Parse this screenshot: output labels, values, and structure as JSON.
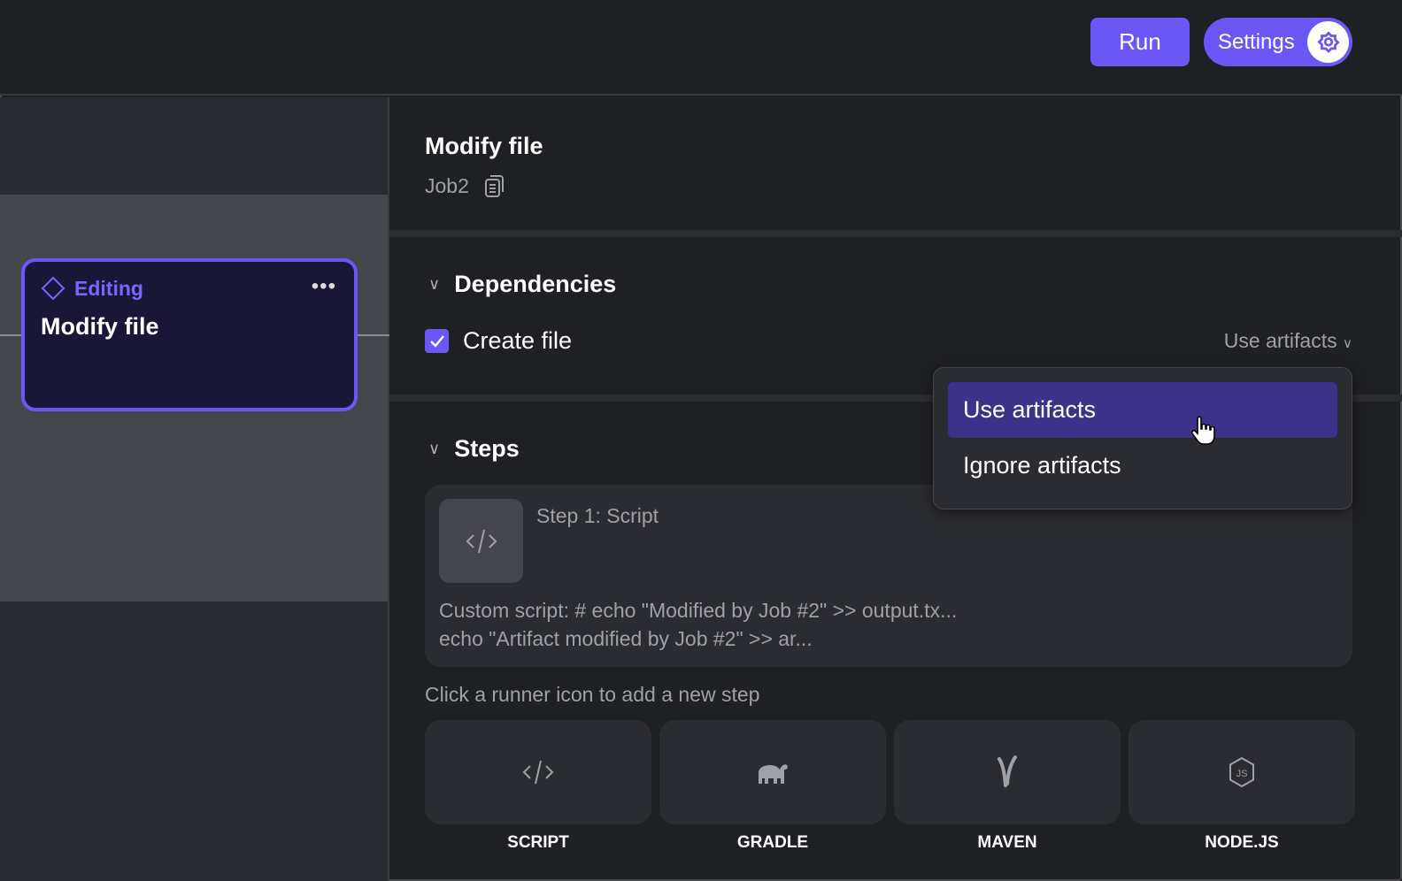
{
  "header": {
    "run_label": "Run",
    "settings_label": "Settings"
  },
  "node": {
    "status": "Editing",
    "title": "Modify file"
  },
  "job": {
    "title": "Modify file",
    "id": "Job2"
  },
  "dependencies": {
    "heading": "Dependencies",
    "items": [
      {
        "label": "Create file",
        "checked": true,
        "mode": "Use artifacts"
      }
    ]
  },
  "dropdown": {
    "options": [
      "Use artifacts",
      "Ignore artifacts"
    ],
    "selected": "Use artifacts"
  },
  "steps": {
    "heading": "Steps",
    "items": [
      {
        "title": "Step 1: Script",
        "line1": "Custom script: # echo \"Modified by Job #2\" >> output.tx...",
        "line2": "echo \"Artifact modified by Job #2\" >> ar..."
      }
    ],
    "hint": "Click a runner icon to add a new step"
  },
  "runners": [
    "SCRIPT",
    "GRADLE",
    "MAVEN",
    "NODE.JS"
  ],
  "colors": {
    "accent": "#6b57f5",
    "selected": "#3c3289"
  }
}
